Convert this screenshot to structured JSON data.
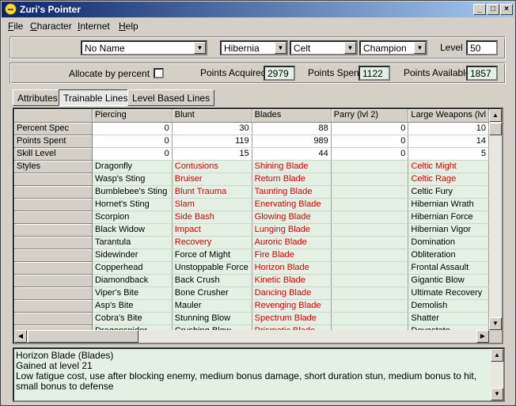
{
  "window": {
    "title": "Zuri's Pointer"
  },
  "menu": [
    {
      "key": "F",
      "rest": "ile"
    },
    {
      "key": "C",
      "rest": "haracter"
    },
    {
      "key": "I",
      "rest": "nternet"
    },
    {
      "key": "H",
      "rest": "elp"
    }
  ],
  "character": {
    "name": "No Name",
    "realm": "Hibernia",
    "race": "Celt",
    "class": "Champion",
    "level_label": "Level",
    "level": "50"
  },
  "points": {
    "allocate_label": "Allocate by percent",
    "allocate_checked": false,
    "acquired_label": "Points Acquired",
    "acquired": "2979",
    "spent_label": "Points Spent",
    "spent": "1122",
    "available_label": "Points Available",
    "available": "1857"
  },
  "tabs": [
    "Attributes",
    "Trainable Lines",
    "Level Based Lines"
  ],
  "active_tab": "Trainable Lines",
  "grid": {
    "columns": [
      "Piercing",
      "Blunt",
      "Blades",
      "Parry (lvl 2)",
      "Large Weapons (lvl"
    ],
    "stat_rows": [
      {
        "label": "Percent Spec",
        "values": [
          "0",
          "30",
          "88",
          "0",
          "10"
        ]
      },
      {
        "label": "Points Spent",
        "values": [
          "0",
          "119",
          "989",
          "0",
          "14"
        ]
      },
      {
        "label": "Skill Level",
        "values": [
          "0",
          "15",
          "44",
          "0",
          "5"
        ]
      }
    ],
    "styles_label": "Styles",
    "style_rows": [
      [
        "Dragonfly",
        "Contusions",
        "Shining Blade",
        "",
        "Celtic Might"
      ],
      [
        "Wasp's Sting",
        "Bruiser",
        "Return Blade",
        "",
        "Celtic Rage"
      ],
      [
        "Bumblebee's Sting",
        "Blunt Trauma",
        "Taunting Blade",
        "",
        "Celtic Fury"
      ],
      [
        "Hornet's Sting",
        "Slam",
        "Enervating Blade",
        "",
        "Hibernian Wrath"
      ],
      [
        "Scorpion",
        "Side Bash",
        "Glowing Blade",
        "",
        "Hibernian Force"
      ],
      [
        "Black Widow",
        "Impact",
        "Lunging Blade",
        "",
        "Hibernian Vigor"
      ],
      [
        "Tarantula",
        "Recovery",
        "Auroric Blade",
        "",
        "Domination"
      ],
      [
        "Sidewinder",
        "Force of Might",
        "Fire Blade",
        "",
        "Obliteration"
      ],
      [
        "Copperhead",
        "Unstoppable Force",
        "Horizon Blade",
        "",
        "Frontal Assault"
      ],
      [
        "Diamondback",
        "Back Crush",
        "Kinetic Blade",
        "",
        "Gigantic Blow"
      ],
      [
        "Viper's Bite",
        "Bone Crusher",
        "Dancing Blade",
        "",
        "Ultimate Recovery"
      ],
      [
        "Asp's Bite",
        "Mauler",
        "Revenging Blade",
        "",
        "Demolish"
      ],
      [
        "Cobra's Bite",
        "Stunning Blow",
        "Spectrum Blade",
        "",
        "Shatter"
      ],
      [
        "Dragonspider",
        "Crushing Blow",
        "Prismatic Blade",
        "",
        "Devastate"
      ]
    ],
    "red_cells": [
      [
        0,
        1
      ],
      [
        1,
        1
      ],
      [
        2,
        1
      ],
      [
        3,
        1
      ],
      [
        4,
        1
      ],
      [
        5,
        1
      ],
      [
        6,
        1
      ],
      [
        0,
        2
      ],
      [
        1,
        2
      ],
      [
        2,
        2
      ],
      [
        3,
        2
      ],
      [
        4,
        2
      ],
      [
        5,
        2
      ],
      [
        6,
        2
      ],
      [
        7,
        2
      ],
      [
        8,
        2
      ],
      [
        9,
        2
      ],
      [
        10,
        2
      ],
      [
        11,
        2
      ],
      [
        12,
        2
      ],
      [
        13,
        2
      ],
      [
        0,
        4
      ],
      [
        1,
        4
      ]
    ],
    "colors": {
      "available": "#d40000",
      "grid_bg": "#e4f0e4"
    }
  },
  "description": {
    "lines": [
      "Horizon Blade (Blades)",
      "Gained at level 21",
      "Low fatigue cost, use after blocking enemy, medium bonus damage, short duration stun, medium bonus to hit, small bonus to defense"
    ]
  }
}
